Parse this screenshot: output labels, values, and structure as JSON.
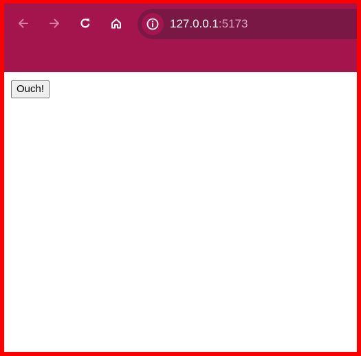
{
  "browser": {
    "toolbar_color": "#a3154c",
    "omnibox_color": "#7a1845",
    "back_icon": "arrow-left-icon",
    "forward_icon": "arrow-right-icon",
    "reload_icon": "reload-icon",
    "home_icon": "home-icon",
    "site_info_icon": "info-icon",
    "url_host": "127.0.0.1",
    "url_port": ":5173"
  },
  "page": {
    "button_label": "Ouch!"
  },
  "frame_color": "#ff0000"
}
